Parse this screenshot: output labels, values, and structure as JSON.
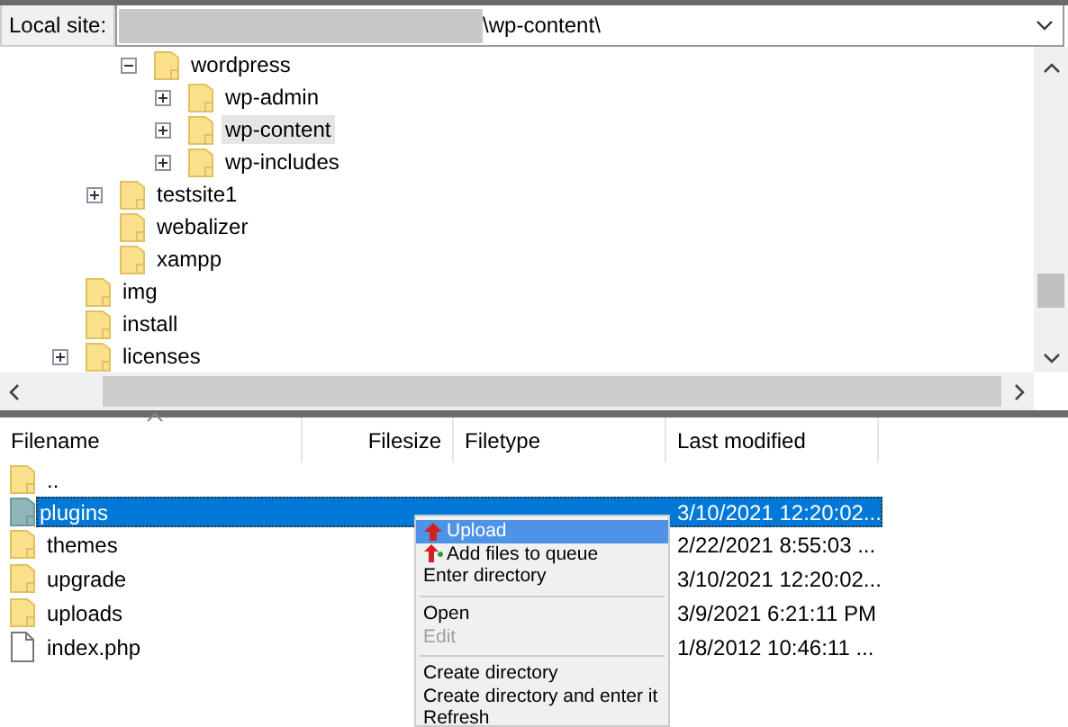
{
  "local_site": {
    "label": "Local site:",
    "value": "\\wp-content\\"
  },
  "tree": {
    "items": [
      {
        "children": [
          {
            "children": [
              {
                "label": "wordpress",
                "expanded": true,
                "selected": false,
                "children": [
                  {
                    "label": "wp-admin",
                    "expanded": false,
                    "selected": false
                  },
                  {
                    "label": "wp-content",
                    "expanded": false,
                    "selected": true
                  },
                  {
                    "label": "wp-includes",
                    "expanded": false,
                    "selected": false
                  }
                ]
              }
            ]
          },
          {
            "label": "testsite1",
            "expanded": false,
            "selected": false
          },
          {
            "label": "webalizer",
            "selected": false
          },
          {
            "label": "xampp",
            "selected": false
          }
        ]
      },
      {
        "label": "img",
        "selected": false
      },
      {
        "label": "install",
        "selected": false
      },
      {
        "label": "licenses",
        "expanded": false,
        "selected": false
      }
    ]
  },
  "file_list": {
    "columns": [
      "Filename",
      "Filesize",
      "Filetype",
      "Last modified"
    ],
    "rows": [
      {
        "kind": "folder",
        "name": "..",
        "selected": false
      },
      {
        "kind": "folder",
        "name": "plugins",
        "last_modified": "3/10/2021 12:20:02...",
        "selected": true
      },
      {
        "kind": "folder",
        "name": "themes",
        "last_modified": "2/22/2021 8:55:03 ...",
        "selected": false
      },
      {
        "kind": "folder",
        "name": "upgrade",
        "last_modified": "3/10/2021 12:20:02...",
        "selected": false
      },
      {
        "kind": "folder",
        "name": "uploads",
        "last_modified": "3/9/2021 6:21:11 PM",
        "selected": false
      },
      {
        "kind": "file",
        "name": "index.php",
        "last_modified": "1/8/2012 10:46:11 ...",
        "selected": false
      }
    ]
  },
  "context_menu": {
    "items": [
      {
        "kind": "upload",
        "label": "Upload",
        "selected": true,
        "disabled": false
      },
      {
        "kind": "queue",
        "label": "Add files to queue",
        "selected": false,
        "disabled": false
      },
      {
        "kind": "item",
        "label": "Enter directory",
        "selected": false,
        "disabled": false
      },
      {
        "kind": "separator"
      },
      {
        "kind": "item",
        "label": "Open",
        "selected": false,
        "disabled": false
      },
      {
        "kind": "item",
        "label": "Edit",
        "selected": false,
        "disabled": true
      },
      {
        "kind": "separator"
      },
      {
        "kind": "item",
        "label": "Create directory",
        "selected": false,
        "disabled": false
      },
      {
        "kind": "item",
        "label": "Create directory and enter it",
        "selected": false,
        "disabled": false
      },
      {
        "kind": "item",
        "label": "Refresh",
        "selected": false,
        "disabled": false
      }
    ]
  }
}
